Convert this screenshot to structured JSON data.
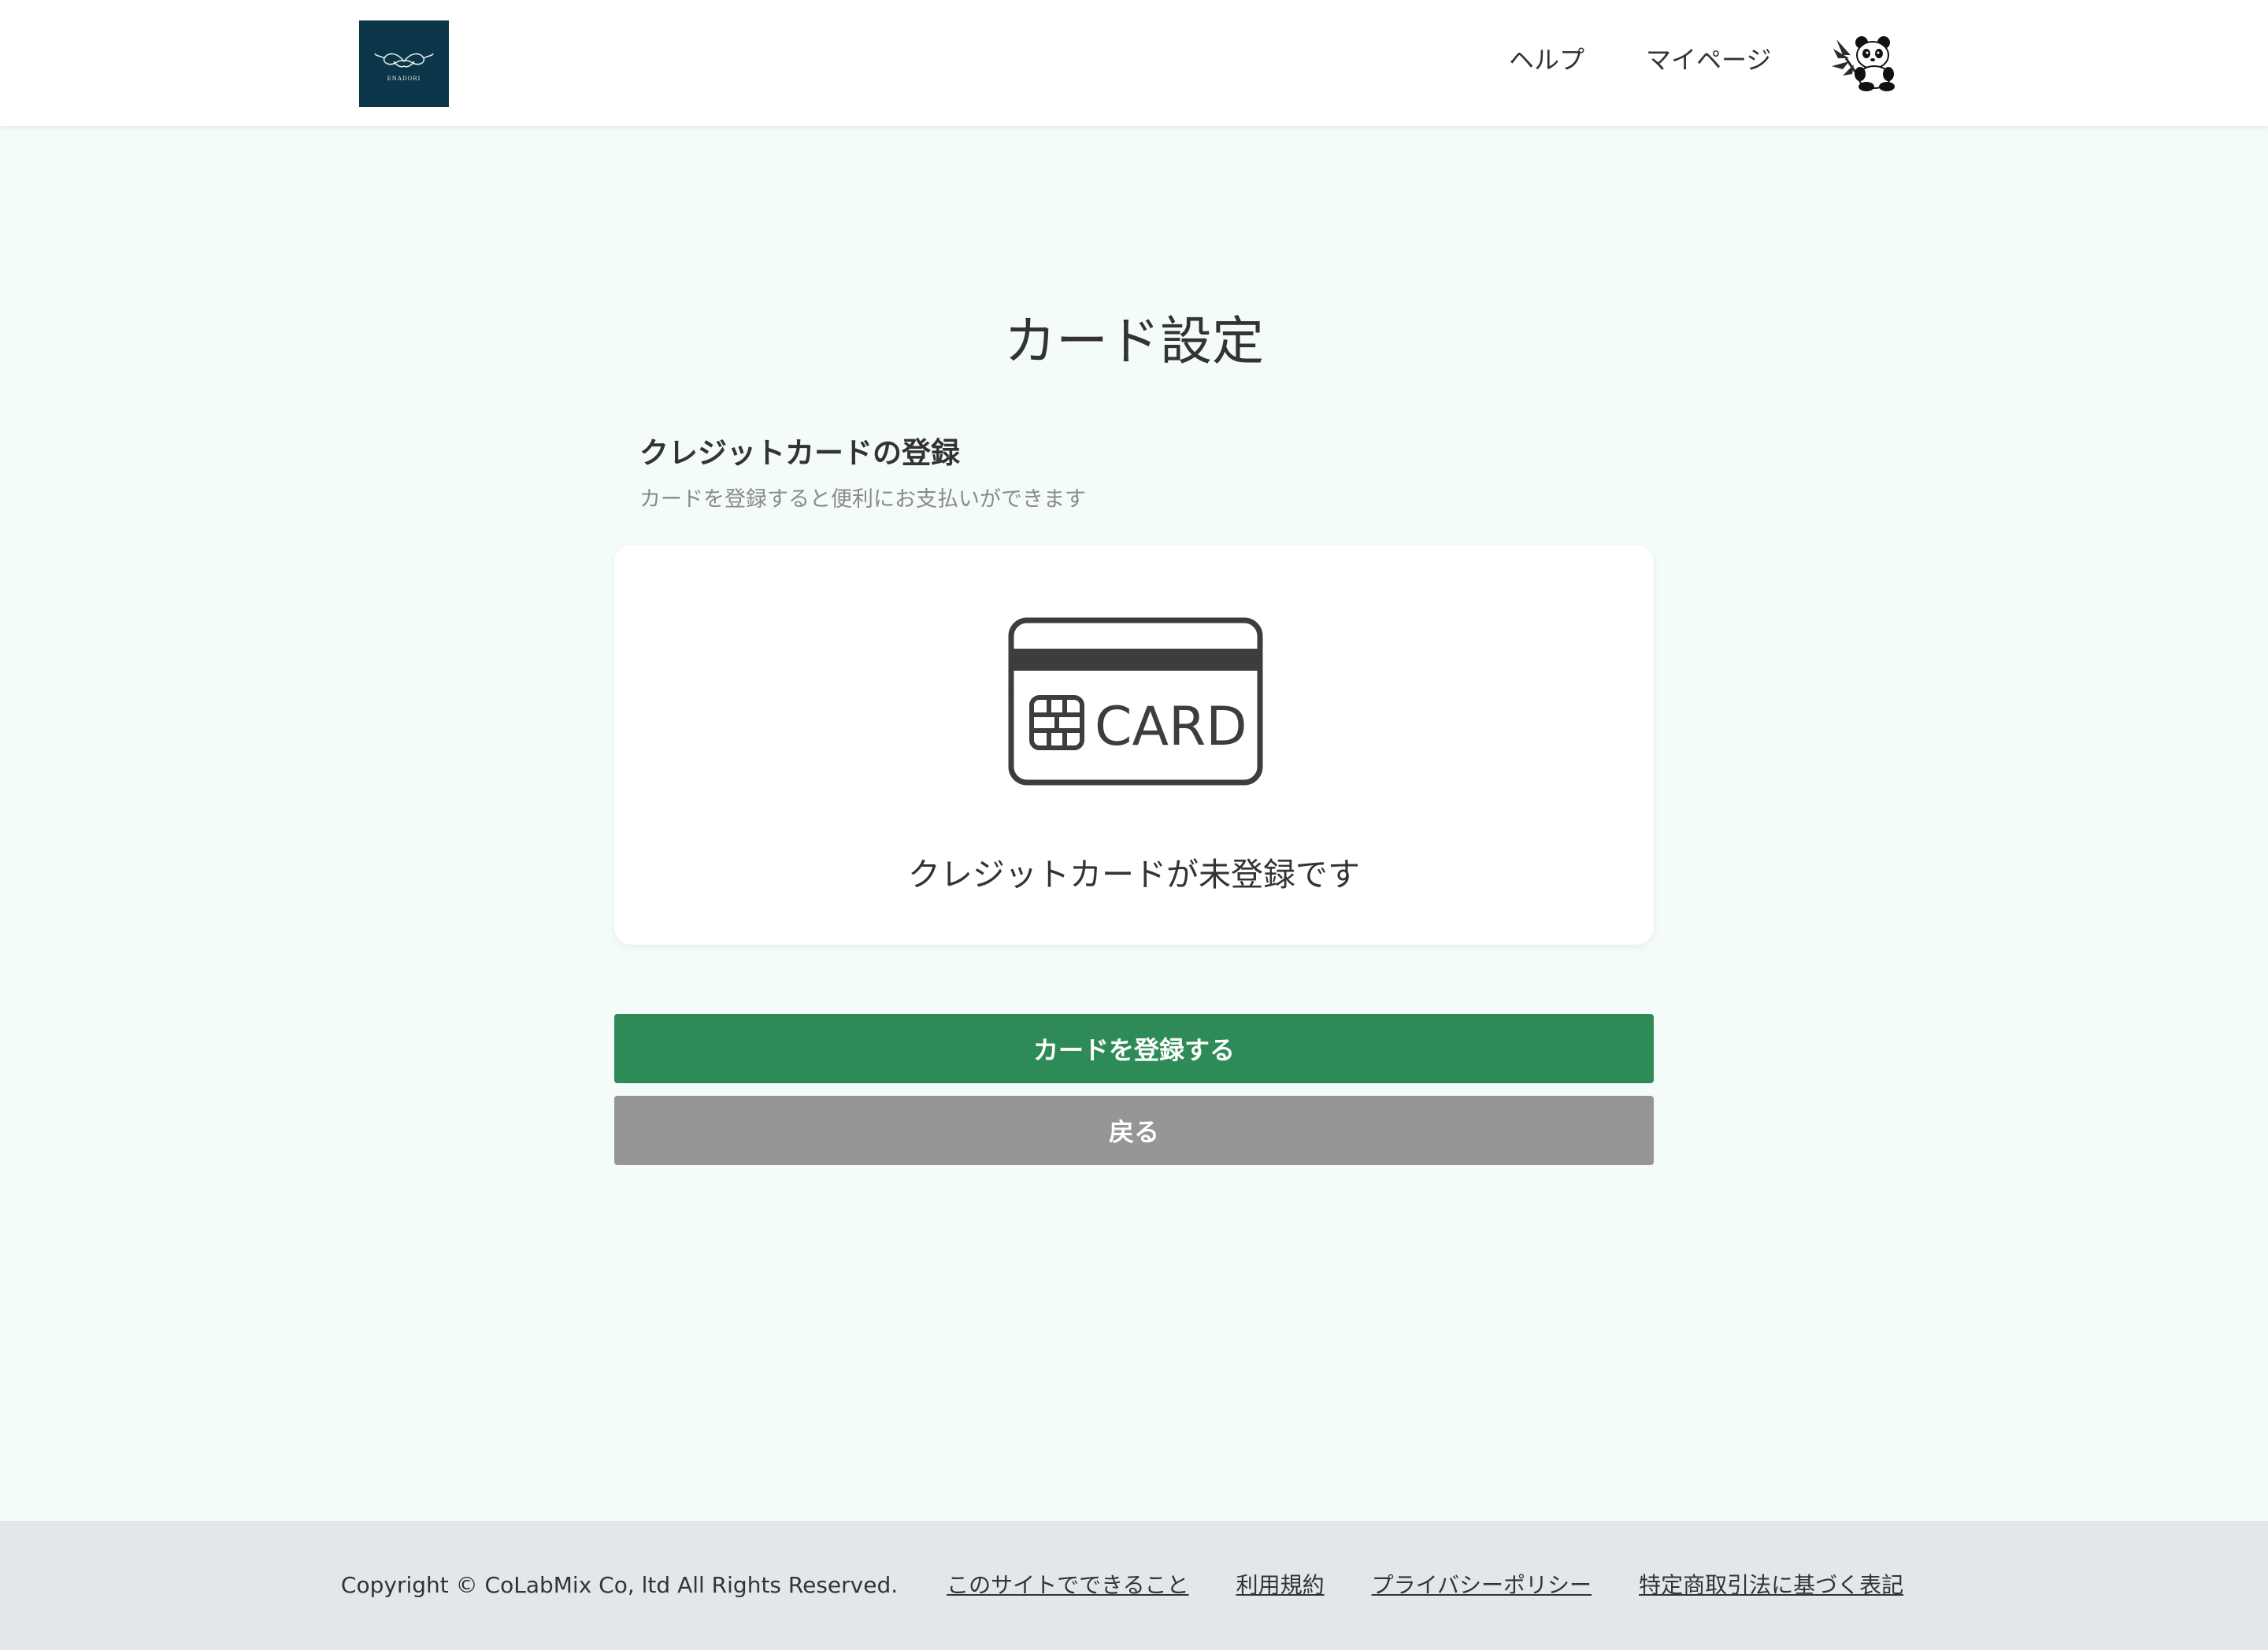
{
  "header": {
    "logo_text": "ENADORI",
    "nav": {
      "help": "ヘルプ",
      "mypage": "マイページ"
    }
  },
  "main": {
    "title": "カード設定",
    "section_title": "クレジットカードの登録",
    "section_subtitle": "カードを登録すると便利にお支払いができます",
    "card_icon_text": "CARD",
    "status_text": "クレジットカードが未登録です",
    "register_button": "カードを登録する",
    "back_button": "戻る"
  },
  "footer": {
    "copyright": "Copyright © CoLabMix Co, ltd All Rights Reserved.",
    "links": [
      "このサイトでできること",
      "利用規約",
      "プライバシーポリシー",
      "特定商取引法に基づく表記"
    ]
  },
  "colors": {
    "background": "#f3fcf8",
    "primary_button": "#2e8b57",
    "secondary_button": "#969696",
    "logo_bg": "#0b3548",
    "footer_bg": "#e3e7eb"
  }
}
